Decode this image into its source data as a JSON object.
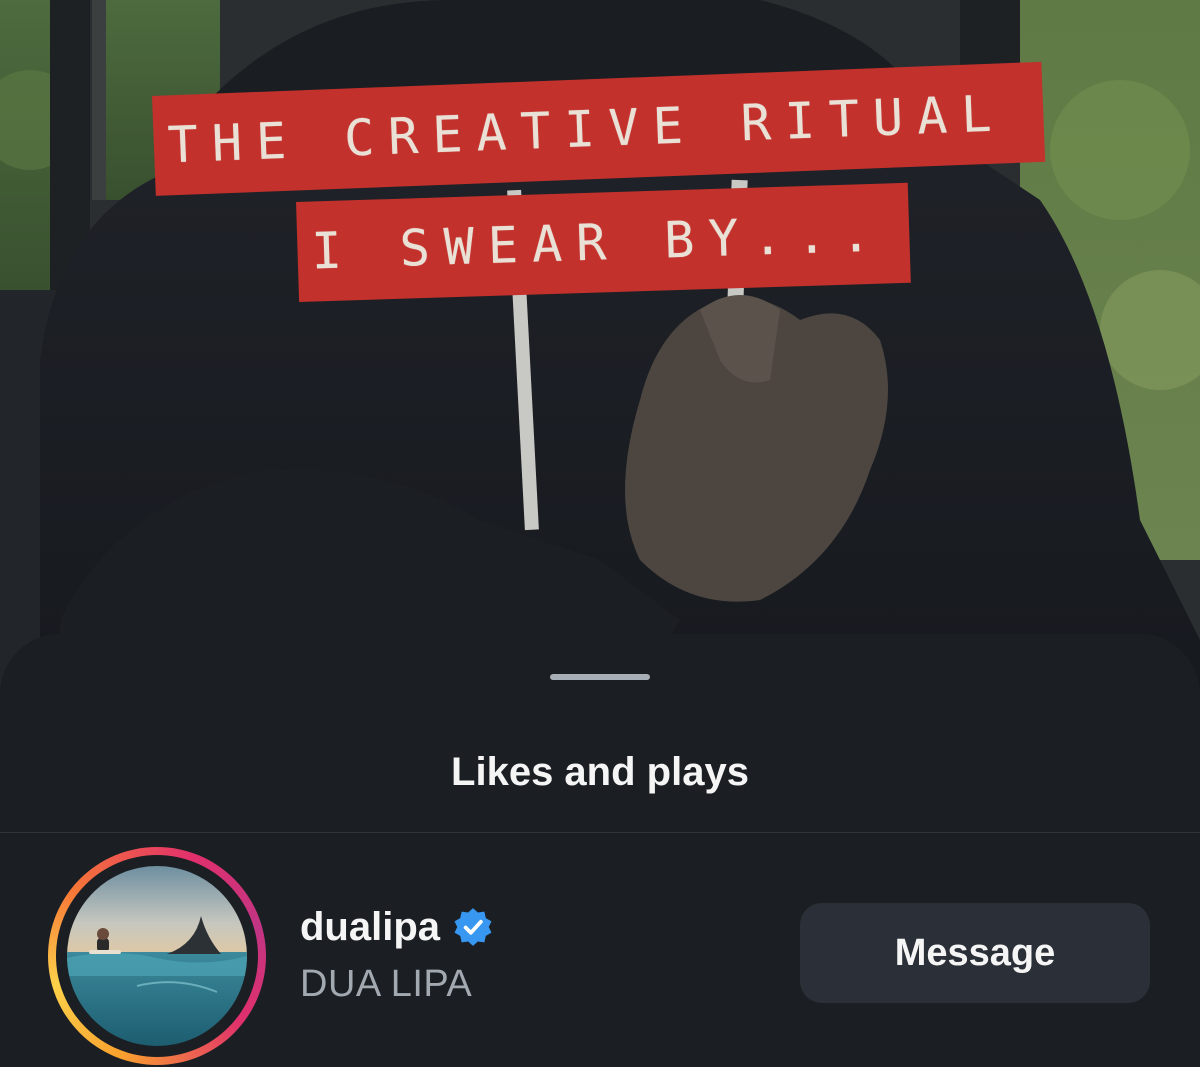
{
  "video": {
    "caption_line_1": "THE CREATIVE RITUAL",
    "caption_line_2": "I SWEAR BY..."
  },
  "sheet": {
    "title": "Likes and plays"
  },
  "user": {
    "username": "dualipa",
    "full_name": "DUA LIPA",
    "verified": true,
    "message_label": "Message",
    "avatar_icon": "surfer-with-shark-fin-photo"
  },
  "colors": {
    "caption_background": "#c3312c",
    "sheet_background": "#1b1f24",
    "button_background": "#2b3038",
    "verified_badge": "#3897f0"
  }
}
